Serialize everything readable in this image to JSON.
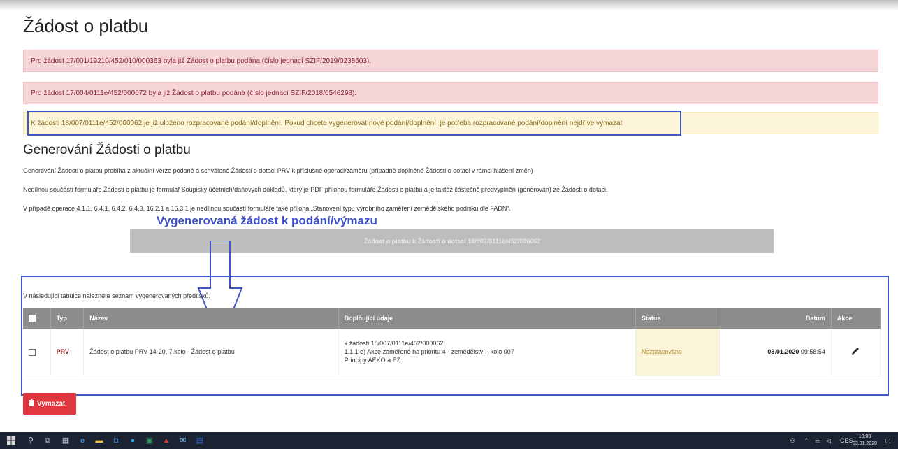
{
  "page": {
    "title": "Žádost o platbu"
  },
  "alerts": [
    {
      "text": "Pro žádost 17/001/19210/452/010/000363 byla již Žádost o platbu podána (číslo jednací SZIF/2019/0238603)."
    },
    {
      "text": "Pro žádost 17/004/0111e/452/000072 byla již Žádost o platbu podána (číslo jednací SZIF/2018/0546298)."
    },
    {
      "text": "K žádosti 18/007/0111e/452/000062 je již uloženo rozpracované podání/doplnění. Pokud chcete vygenerovat nové podání/doplnění, je potřeba rozpracované podání/doplnění nejdříve vymazat"
    }
  ],
  "generation": {
    "heading": "Generování Žádosti o platbu",
    "paragraphs": [
      "Generování Žádosti o platbu probíhá z aktuální verze podané a schválené Žádosti o dotaci PRV k příslušné operaci/záměru (případně doplněné Žádosti o dotaci v rámci hlášení změn)",
      "Nedílnou součástí formuláře Žádosti o platbu je formulář Soupisky účetních/daňových dokladů, který je PDF přílohou formuláře Žádosti o platbu a je taktéž částečně předvyplněn (generován) ze Žádosti o dotaci.",
      "V případě operace 4.1.1, 6.4.1, 6.4.2, 6.4.3, 16.2.1 a 16.3.1 je nedílnou součástí formuláře také příloha „Stanovení typu výrobního zaměření zemědělského podniku dle FADN“."
    ],
    "button_label": "Žádost o platbu k Žádosti o dotaci 18/007/0111e/452/000062"
  },
  "annotation": {
    "label": "Vygenerovaná žádost k podání/výmazu"
  },
  "table": {
    "intro": "V následující tabulce naleznete seznam vygenerovaných předtisků.",
    "headers": {
      "type": "Typ",
      "name": "Název",
      "details": "Doplňující údaje",
      "status": "Status",
      "date": "Datum",
      "action": "Akce"
    },
    "rows": [
      {
        "type": "PRV",
        "name": "Žádost o platbu PRV 14-20, 7.kolo - Žádost o platbu",
        "details": [
          "k žádosti 18/007/0111e/452/000062",
          "1.1.1 e) Akce zaměřené na prioritu 4 - zemědělství - kolo 007",
          "Principy AEKO a EZ"
        ],
        "status": "Nezpracováno",
        "date": "03.01.2020",
        "time": "09:58:54",
        "action_icon": "pencil-icon"
      }
    ]
  },
  "delete_button": {
    "label": "Vymazat",
    "icon": "trash-icon"
  },
  "taskbar": {
    "language": "CES",
    "time": "10:00",
    "date": "03.01.2020",
    "icons": [
      "windows-start-icon",
      "search-icon",
      "task-view-icon",
      "calculator-icon",
      "edge-icon",
      "file-explorer-icon",
      "outlook-icon",
      "skype-icon",
      "excel-icon",
      "acrobat-icon",
      "mail-icon",
      "word-icon"
    ]
  },
  "colors": {
    "danger_bg": "#f5d5d8",
    "warning_bg": "#fcf4d9",
    "annotation_blue": "#4055c8",
    "table_header": "#8c8c8c",
    "delete_red": "#e0363f",
    "type_text": "#8b1a1a"
  }
}
